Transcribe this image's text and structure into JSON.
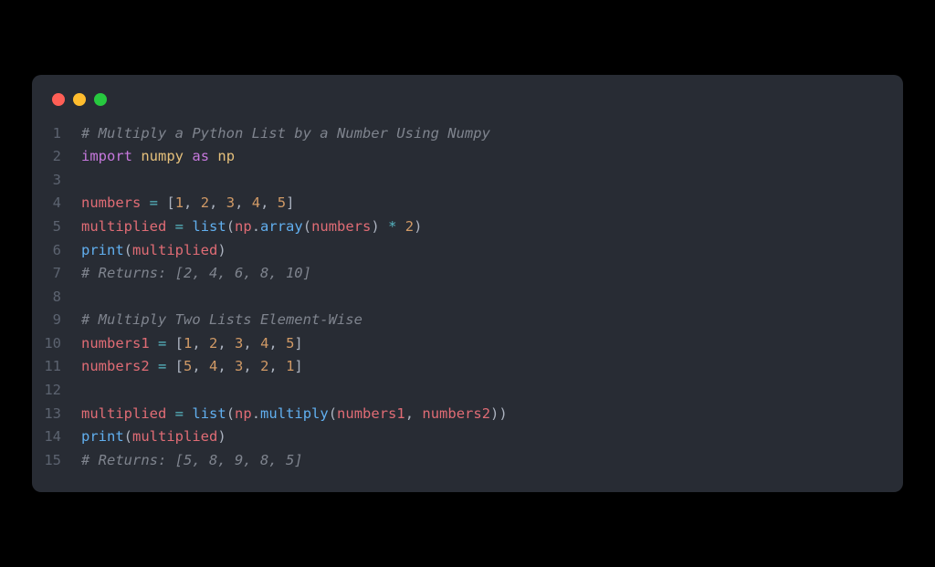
{
  "window": {
    "dots": [
      "red",
      "yellow",
      "green"
    ]
  },
  "colors": {
    "bg_outer": "#000000",
    "bg_window": "#282c34",
    "lineno": "#5c6370",
    "comment": "#7f848e",
    "keyword": "#c678dd",
    "module": "#e5c07b",
    "variable": "#e06c75",
    "operator": "#56b6c2",
    "number": "#d19a66",
    "function": "#61afef",
    "default": "#abb2bf"
  },
  "code": {
    "lines": [
      {
        "n": "1",
        "tokens": [
          [
            "comment",
            "# Multiply a Python List by a Number Using Numpy"
          ]
        ]
      },
      {
        "n": "2",
        "tokens": [
          [
            "keyword",
            "import"
          ],
          [
            "default",
            " "
          ],
          [
            "module",
            "numpy"
          ],
          [
            "default",
            " "
          ],
          [
            "keyword",
            "as"
          ],
          [
            "default",
            " "
          ],
          [
            "module",
            "np"
          ]
        ]
      },
      {
        "n": "3",
        "tokens": []
      },
      {
        "n": "4",
        "tokens": [
          [
            "var",
            "numbers"
          ],
          [
            "default",
            " "
          ],
          [
            "op",
            "="
          ],
          [
            "default",
            " ["
          ],
          [
            "num",
            "1"
          ],
          [
            "default",
            ", "
          ],
          [
            "num",
            "2"
          ],
          [
            "default",
            ", "
          ],
          [
            "num",
            "3"
          ],
          [
            "default",
            ", "
          ],
          [
            "num",
            "4"
          ],
          [
            "default",
            ", "
          ],
          [
            "num",
            "5"
          ],
          [
            "default",
            "]"
          ]
        ]
      },
      {
        "n": "5",
        "tokens": [
          [
            "var",
            "multiplied"
          ],
          [
            "default",
            " "
          ],
          [
            "op",
            "="
          ],
          [
            "default",
            " "
          ],
          [
            "func",
            "list"
          ],
          [
            "default",
            "("
          ],
          [
            "var",
            "np"
          ],
          [
            "default",
            "."
          ],
          [
            "func",
            "array"
          ],
          [
            "default",
            "("
          ],
          [
            "var",
            "numbers"
          ],
          [
            "default",
            ") "
          ],
          [
            "op",
            "*"
          ],
          [
            "default",
            " "
          ],
          [
            "num",
            "2"
          ],
          [
            "default",
            ")"
          ]
        ]
      },
      {
        "n": "6",
        "tokens": [
          [
            "func",
            "print"
          ],
          [
            "default",
            "("
          ],
          [
            "var",
            "multiplied"
          ],
          [
            "default",
            ")"
          ]
        ]
      },
      {
        "n": "7",
        "tokens": [
          [
            "comment",
            "# Returns: [2, 4, 6, 8, 10]"
          ]
        ]
      },
      {
        "n": "8",
        "tokens": []
      },
      {
        "n": "9",
        "tokens": [
          [
            "comment",
            "# Multiply Two Lists Element-Wise"
          ]
        ]
      },
      {
        "n": "10",
        "tokens": [
          [
            "var",
            "numbers1"
          ],
          [
            "default",
            " "
          ],
          [
            "op",
            "="
          ],
          [
            "default",
            " ["
          ],
          [
            "num",
            "1"
          ],
          [
            "default",
            ", "
          ],
          [
            "num",
            "2"
          ],
          [
            "default",
            ", "
          ],
          [
            "num",
            "3"
          ],
          [
            "default",
            ", "
          ],
          [
            "num",
            "4"
          ],
          [
            "default",
            ", "
          ],
          [
            "num",
            "5"
          ],
          [
            "default",
            "]"
          ]
        ]
      },
      {
        "n": "11",
        "tokens": [
          [
            "var",
            "numbers2"
          ],
          [
            "default",
            " "
          ],
          [
            "op",
            "="
          ],
          [
            "default",
            " ["
          ],
          [
            "num",
            "5"
          ],
          [
            "default",
            ", "
          ],
          [
            "num",
            "4"
          ],
          [
            "default",
            ", "
          ],
          [
            "num",
            "3"
          ],
          [
            "default",
            ", "
          ],
          [
            "num",
            "2"
          ],
          [
            "default",
            ", "
          ],
          [
            "num",
            "1"
          ],
          [
            "default",
            "]"
          ]
        ]
      },
      {
        "n": "12",
        "tokens": []
      },
      {
        "n": "13",
        "tokens": [
          [
            "var",
            "multiplied"
          ],
          [
            "default",
            " "
          ],
          [
            "op",
            "="
          ],
          [
            "default",
            " "
          ],
          [
            "func",
            "list"
          ],
          [
            "default",
            "("
          ],
          [
            "var",
            "np"
          ],
          [
            "default",
            "."
          ],
          [
            "func",
            "multiply"
          ],
          [
            "default",
            "("
          ],
          [
            "var",
            "numbers1"
          ],
          [
            "default",
            ", "
          ],
          [
            "var",
            "numbers2"
          ],
          [
            "default",
            "))"
          ]
        ]
      },
      {
        "n": "14",
        "tokens": [
          [
            "func",
            "print"
          ],
          [
            "default",
            "("
          ],
          [
            "var",
            "multiplied"
          ],
          [
            "default",
            ")"
          ]
        ]
      },
      {
        "n": "15",
        "tokens": [
          [
            "comment",
            "# Returns: [5, 8, 9, 8, 5]"
          ]
        ]
      }
    ]
  }
}
